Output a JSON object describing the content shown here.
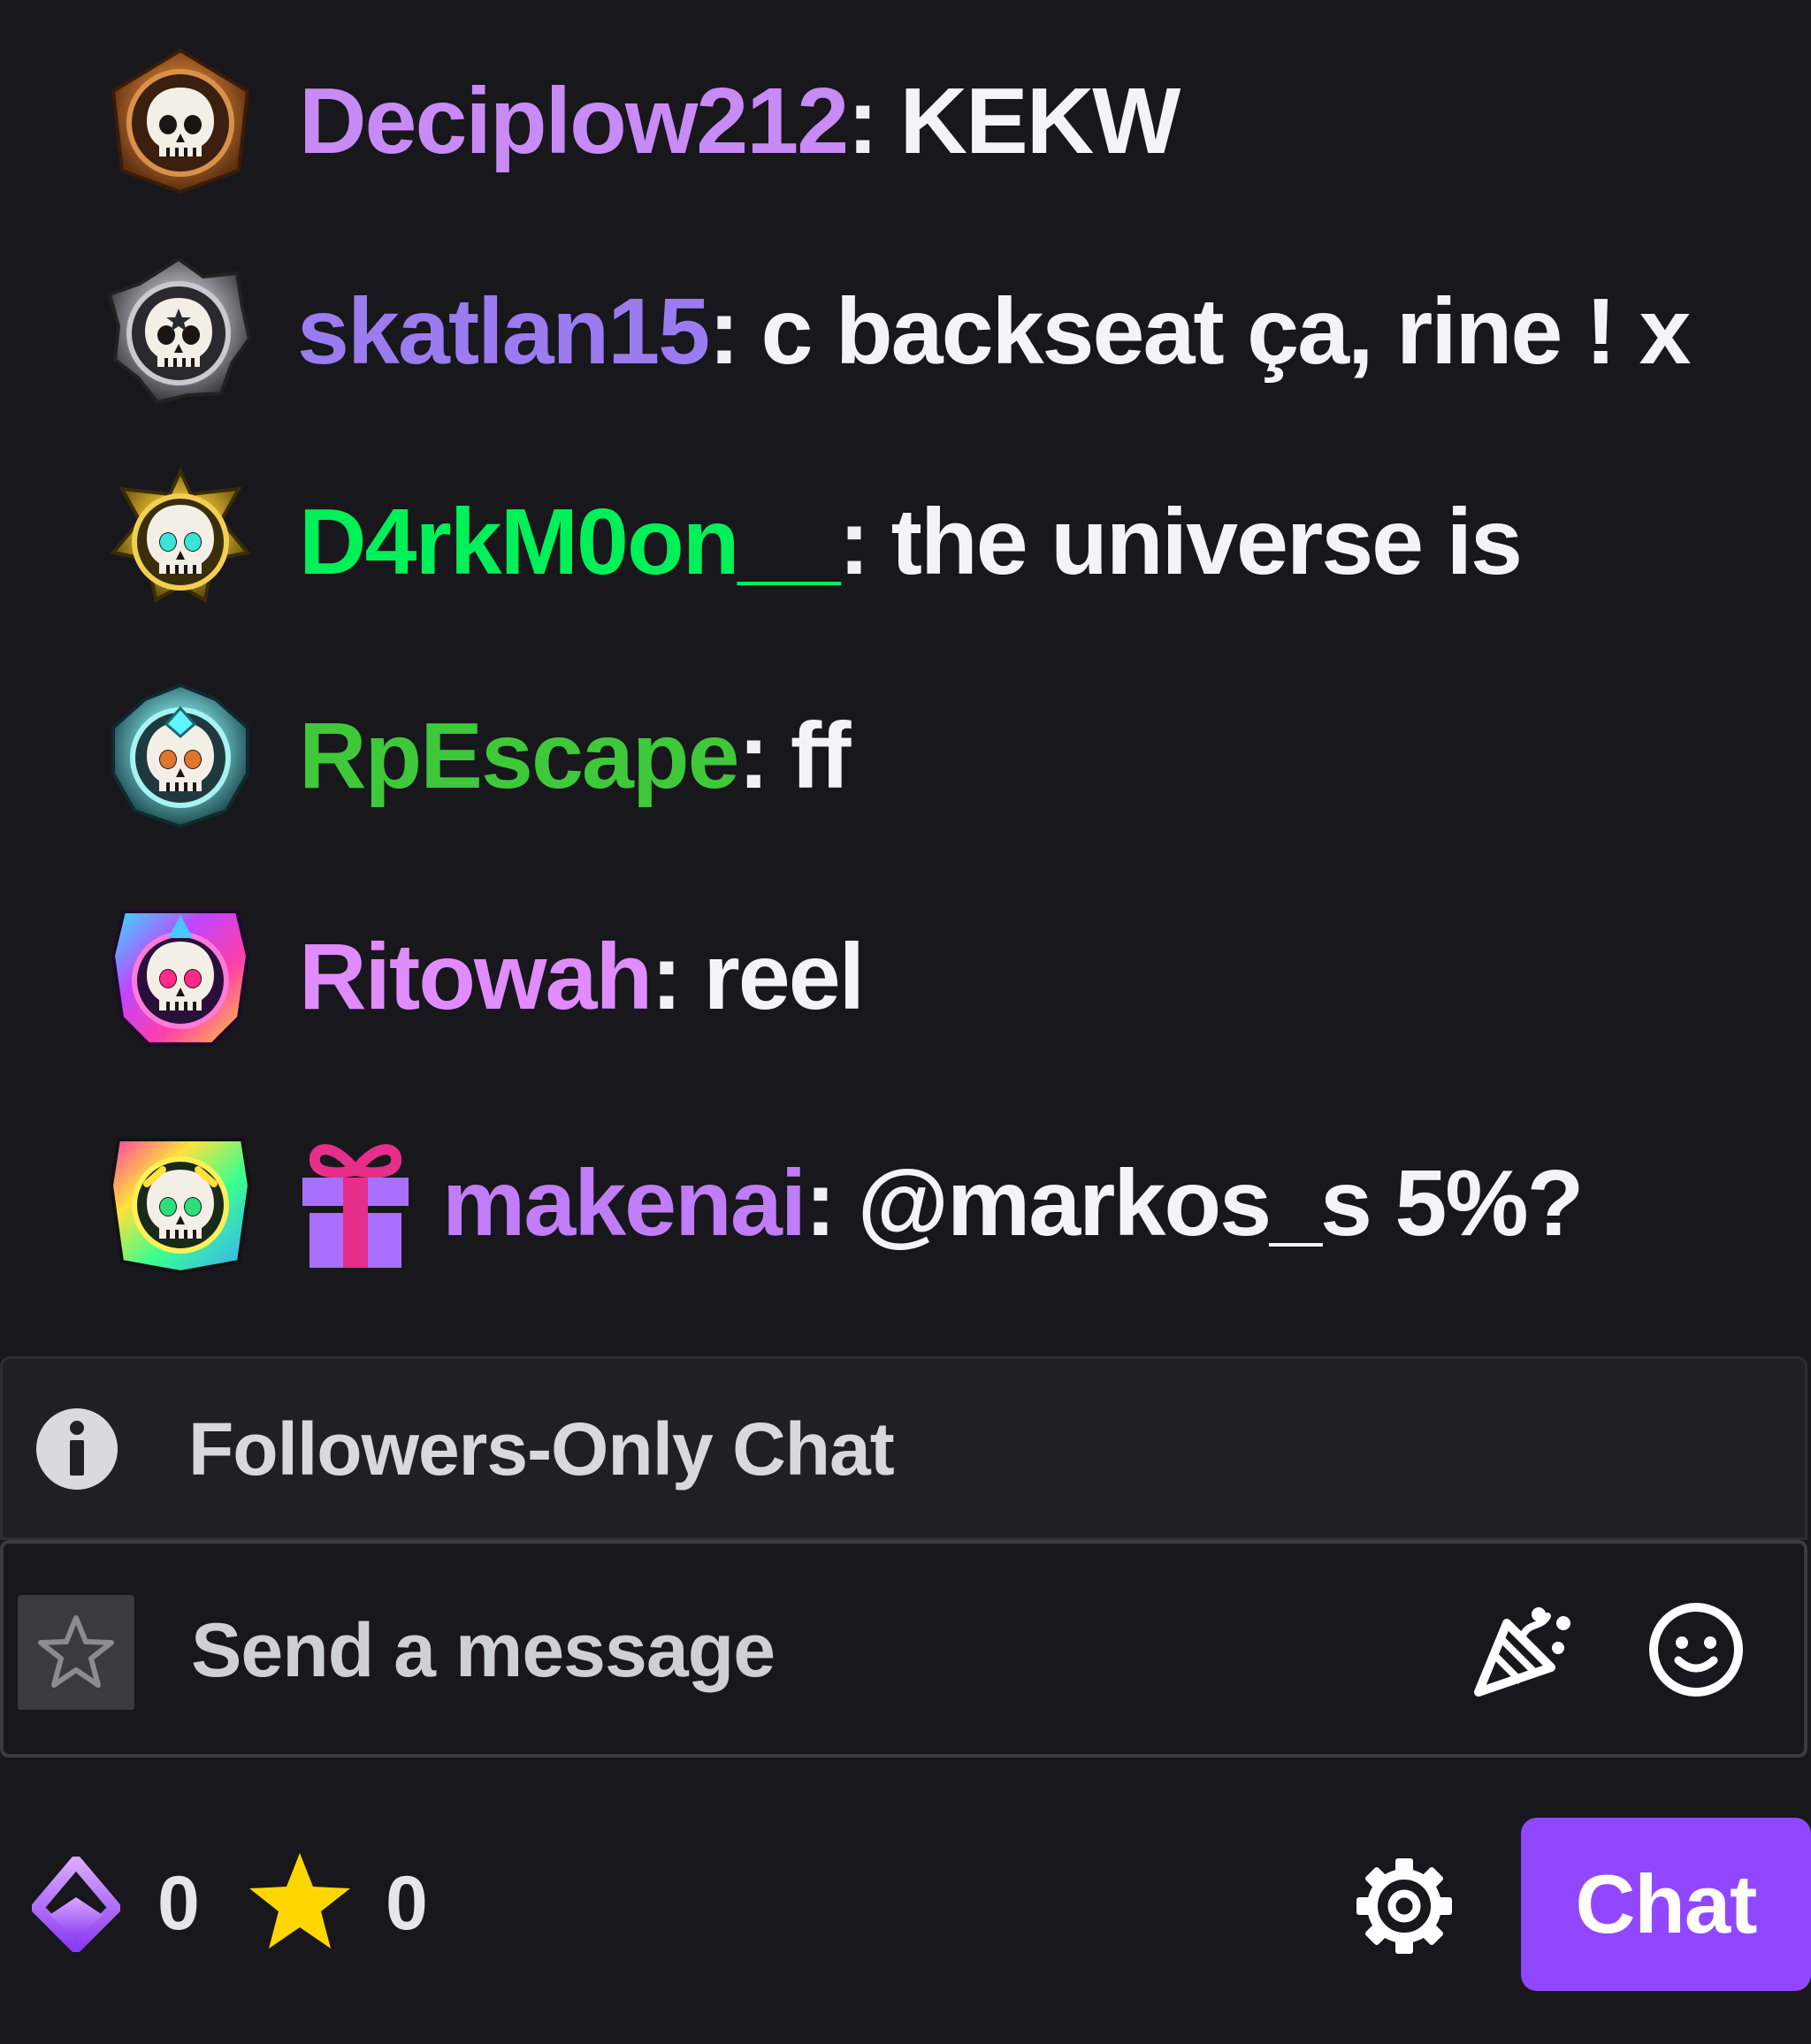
{
  "messages": [
    {
      "username": "Deciplow212",
      "color": "#c88bf5",
      "text": "KEKW",
      "badge": "bronze-skull-emblem"
    },
    {
      "username": "skatlan15",
      "color": "#9a7cf0",
      "text": "c backseat ça, rine ! x",
      "badge": "silver-skull-emblem"
    },
    {
      "username": "D4rkM0on__",
      "color": "#00f05a",
      "text": "the universe is",
      "badge": "gold-winged-skull-emblem"
    },
    {
      "username": "RpEscape",
      "color": "#3ec83a",
      "text": "ff",
      "badge": "diamond-skull-emblem"
    },
    {
      "username": "Ritowah",
      "color": "#e08cff",
      "text": "reel",
      "badge": "iridescent-skull-emblem"
    },
    {
      "username": "makenai",
      "color": "#c07df7",
      "text": "@markos_s 5%?",
      "badge": "rainbow-skull-emblem",
      "extra_icon": "gift-icon"
    }
  ],
  "colon": ":",
  "followers_bar": {
    "icon": "info-icon",
    "text": "Followers-Only Chat"
  },
  "input": {
    "placeholder": "Send a message",
    "left_icon": "star-outline-icon",
    "right_icons": [
      "party-popper-icon",
      "emote-smiley-icon"
    ]
  },
  "bottom": {
    "points_icon": "channel-points-icon",
    "points_count": "0",
    "stars_icon": "star-icon",
    "stars_count": "0",
    "settings_icon": "gear-icon",
    "chat_button_label": "Chat"
  },
  "colors": {
    "background": "#18171c",
    "accent": "#9147ff",
    "gift_pink": "#e62e8a",
    "gift_purple": "#a970ff",
    "star_yellow": "#ffd700"
  }
}
